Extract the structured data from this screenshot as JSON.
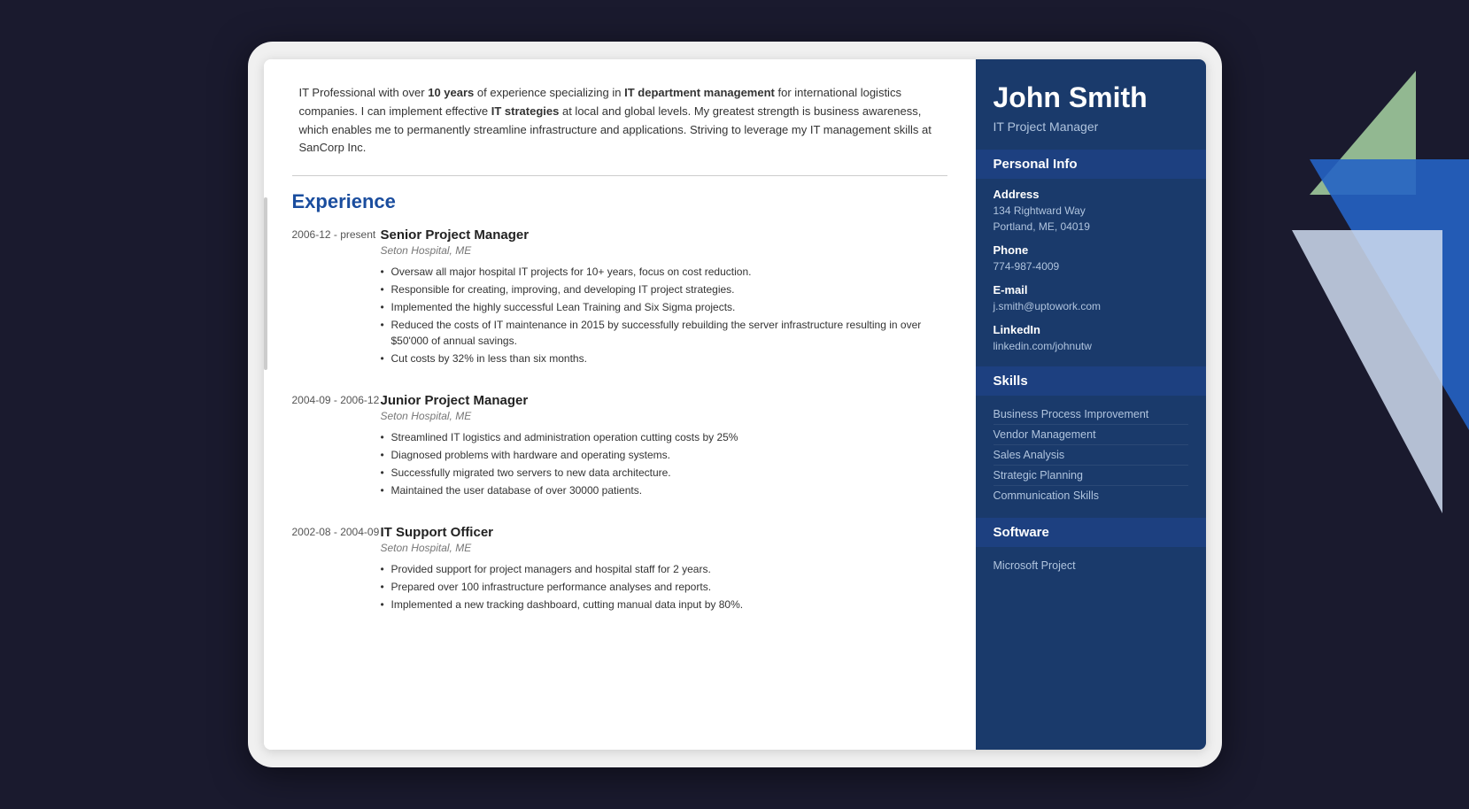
{
  "resume": {
    "name": "John Smith",
    "job_title": "IT Project Manager",
    "summary": {
      "text_parts": [
        {
          "text": "IT Professional with over ",
          "bold": false
        },
        {
          "text": "10 years",
          "bold": true
        },
        {
          "text": " of experience specializing in ",
          "bold": false
        },
        {
          "text": "IT department management",
          "bold": true
        },
        {
          "text": " for international logistics companies. I can implement effective ",
          "bold": false
        },
        {
          "text": "IT strategies",
          "bold": true
        },
        {
          "text": " at local and global levels. My greatest strength is business awareness, which enables me to permanently streamline infrastructure and applications. Striving to leverage my IT management skills at SanCorp Inc.",
          "bold": false
        }
      ]
    },
    "experience_title": "Experience",
    "experience": [
      {
        "date": "2006-12 - present",
        "title": "Senior Project Manager",
        "company": "Seton Hospital, ME",
        "bullets": [
          "Oversaw all major hospital IT projects for 10+ years, focus on cost reduction.",
          "Responsible for creating, improving, and developing IT project strategies.",
          "Implemented the highly successful Lean Training and Six Sigma projects.",
          "Reduced the costs of IT maintenance in 2015 by successfully rebuilding the server infrastructure resulting in over $50'000 of annual savings.",
          "Cut costs by 32% in less than six months."
        ]
      },
      {
        "date": "2004-09 - 2006-12",
        "title": "Junior Project Manager",
        "company": "Seton Hospital, ME",
        "bullets": [
          "Streamlined IT logistics and administration operation cutting costs by 25%",
          "Diagnosed problems with hardware and operating systems.",
          "Successfully migrated two servers to new data architecture.",
          "Maintained the user database of over 30000 patients."
        ]
      },
      {
        "date": "2002-08 - 2004-09",
        "title": "IT Support Officer",
        "company": "Seton Hospital, ME",
        "bullets": [
          "Provided support for project managers and hospital staff for 2 years.",
          "Prepared over 100 infrastructure performance analyses and reports.",
          "Implemented a new tracking dashboard, cutting manual data input by 80%."
        ]
      }
    ],
    "sidebar": {
      "personal_info_header": "Personal Info",
      "address_label": "Address",
      "address_line1": "134 Rightward Way",
      "address_line2": "Portland, ME, 04019",
      "phone_label": "Phone",
      "phone_value": "774-987-4009",
      "email_label": "E-mail",
      "email_value": "j.smith@uptowork.com",
      "linkedin_label": "LinkedIn",
      "linkedin_value": "linkedin.com/johnutw",
      "skills_header": "Skills",
      "skills": [
        "Business Process Improvement",
        "Vendor Management",
        "Sales Analysis",
        "Strategic Planning",
        "Communication Skills"
      ],
      "software_header": "Software",
      "software": [
        "Microsoft Project"
      ]
    }
  }
}
